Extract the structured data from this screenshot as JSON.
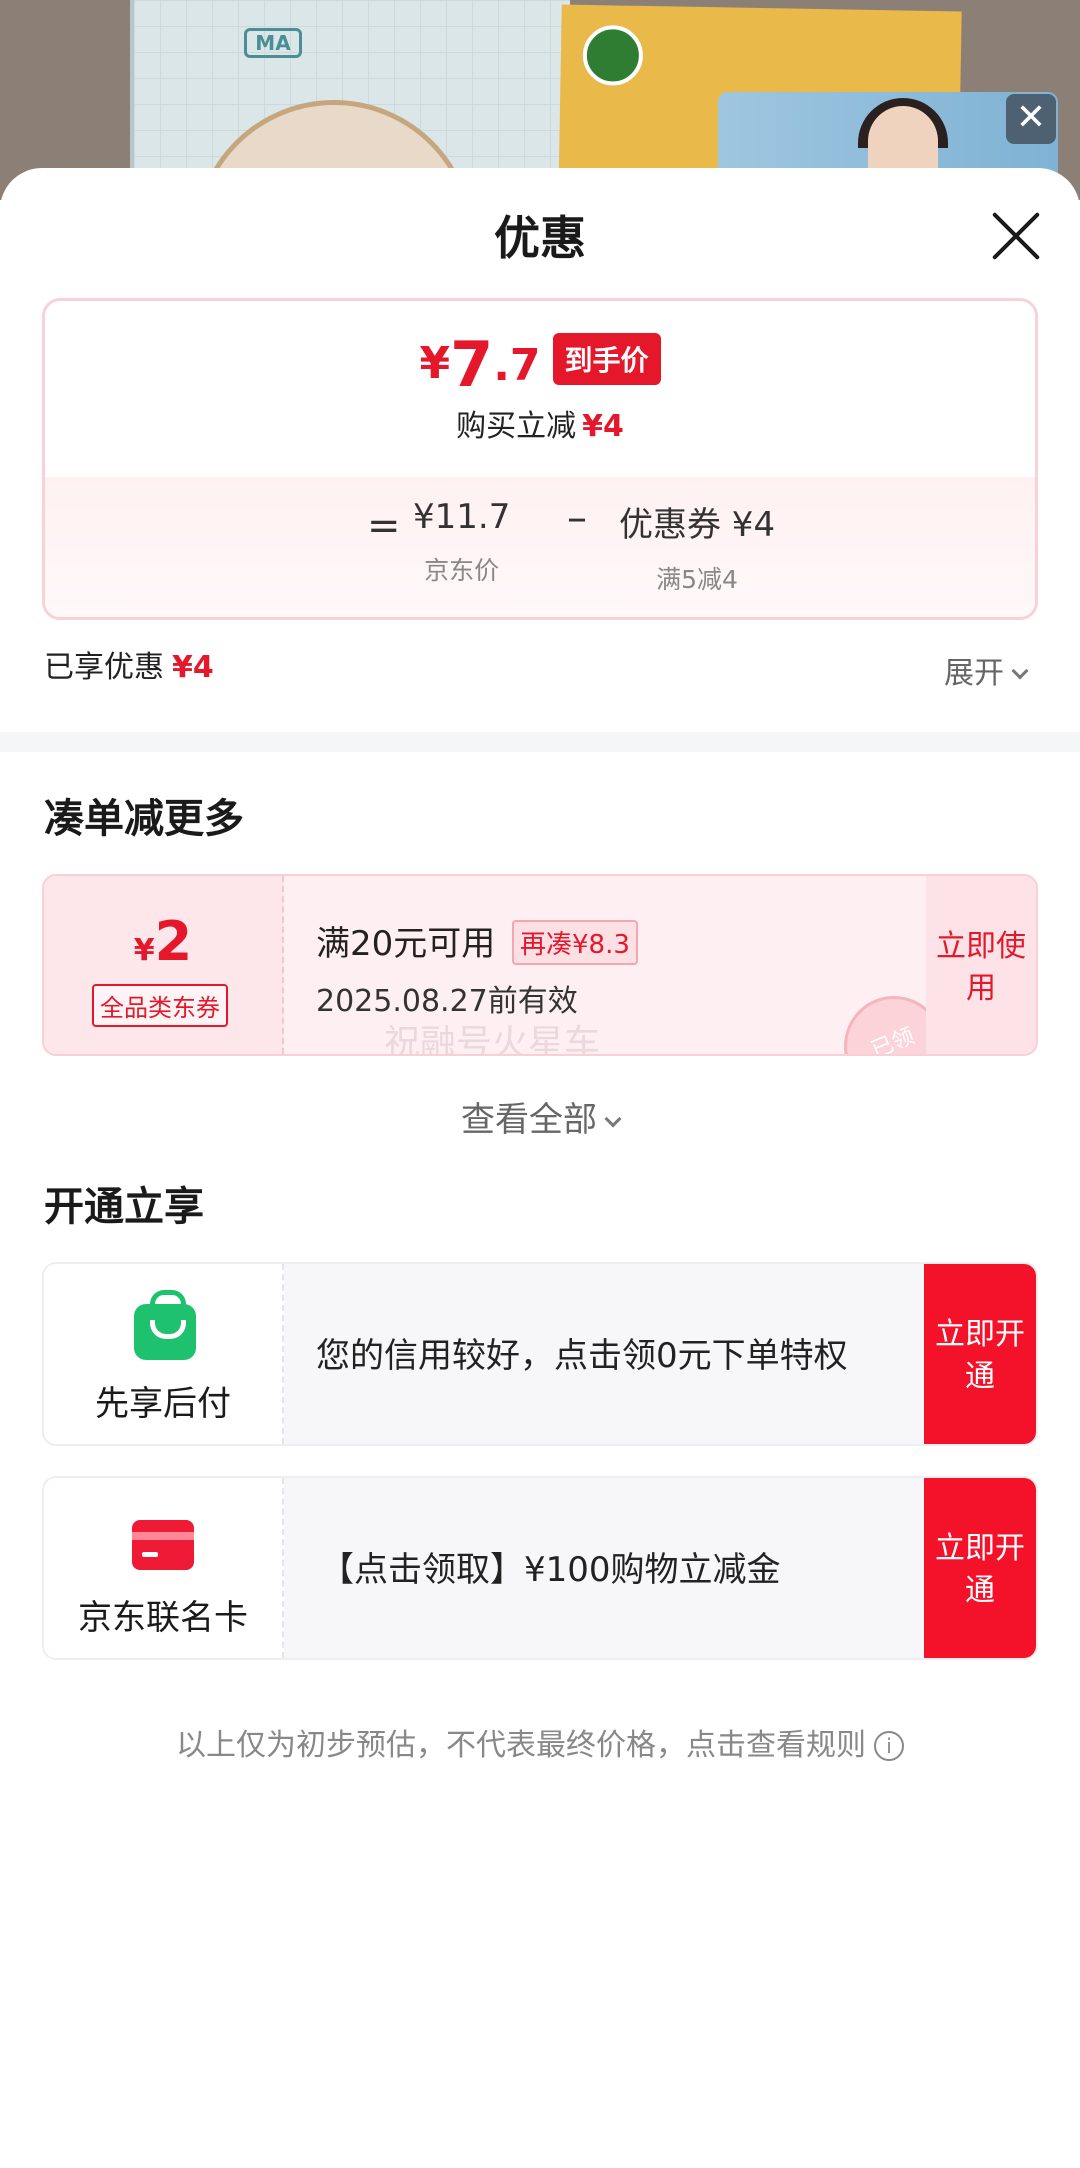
{
  "background": {
    "book_logo": "MA",
    "video_close_glyph": "✕"
  },
  "sheet": {
    "title": "优惠",
    "close_icon": "close-icon"
  },
  "price_card": {
    "final_currency": "¥",
    "final_int": "7",
    "final_dec": ".7",
    "final_badge": "到手价",
    "saving_label": "购买立减",
    "saving_value": "¥4",
    "equals": "=",
    "minus": "–",
    "jd_price": "¥11.7",
    "jd_price_label": "京东价",
    "coupon_value": "优惠券 ¥4",
    "coupon_rule": "满5减4"
  },
  "summary": {
    "enjoyed_label": "已享优惠",
    "enjoyed_value": "¥4",
    "expand_label": "展开"
  },
  "combine": {
    "title": "凑单减更多",
    "coupon": {
      "currency": "¥",
      "amount": "2",
      "type": "全品类东券",
      "condition": "满20元可用",
      "tag": "再凑¥8.3",
      "expiry": "2025.08.27前有效",
      "watermark": "祝融号火星车",
      "stamp": "已领",
      "action": "立即使用"
    },
    "view_all": "查看全部"
  },
  "open": {
    "title": "开通立享",
    "services": [
      {
        "name": "先享后付",
        "icon": "shopping-bag-icon",
        "desc": "您的信用较好，点击领0元下单特权",
        "action": "立即开通"
      },
      {
        "name": "京东联名卡",
        "icon": "credit-card-icon",
        "desc": "【点击领取】¥100购物立减金",
        "action": "立即开通"
      }
    ]
  },
  "footer": {
    "note": "以上仅为初步预估，不代表最终价格，点击查看规则",
    "info_glyph": "i"
  },
  "colors": {
    "accent_red": "#e4182a",
    "action_red": "#f3122a",
    "green": "#1ec26e"
  }
}
